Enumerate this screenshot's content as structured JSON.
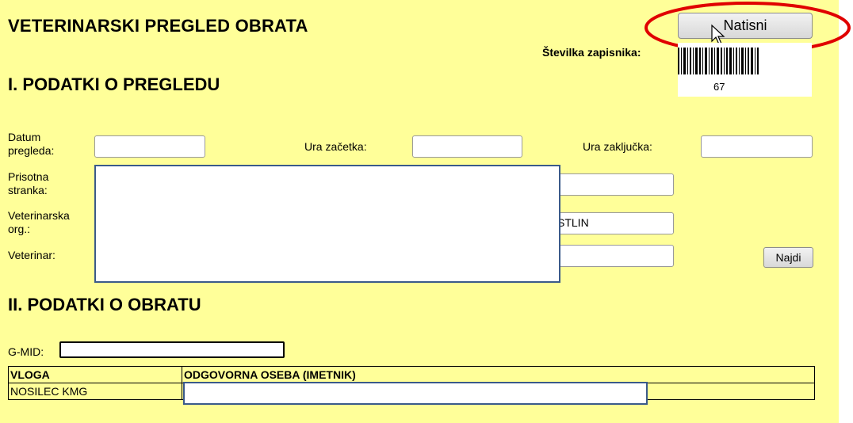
{
  "header": {
    "title": "VETERINARSKI PREGLED OBRATA",
    "print_button": "Natisni",
    "record_number_label": "Številka zapisnika:",
    "record_number": "67"
  },
  "section1": {
    "title": "I. PODATKI O PREGLEDU",
    "date_label_line1": "Datum",
    "date_label_line2": "pregleda:",
    "start_label": "Ura začetka:",
    "end_label": "Ura zaključka:",
    "party_label_line1": "Prisotna",
    "party_label_line2": "stranka:",
    "vetorg_label_line1": "Veterinarska",
    "vetorg_label_line2": "org.:",
    "vetorg_value": "STLIN",
    "vet_label": "Veterinar:",
    "find_button": "Najdi"
  },
  "section2": {
    "title": "II. PODATKI O OBRATU",
    "gmid_label": "G-MID:",
    "table": {
      "headers": [
        "VLOGA",
        "ODGOVORNA OSEBA (IMETNIK)"
      ],
      "rows": [
        [
          "NOSILEC KMG",
          ""
        ]
      ]
    }
  },
  "colors": {
    "panel_background": "#ffff99",
    "highlight_circle": "#e00000"
  }
}
